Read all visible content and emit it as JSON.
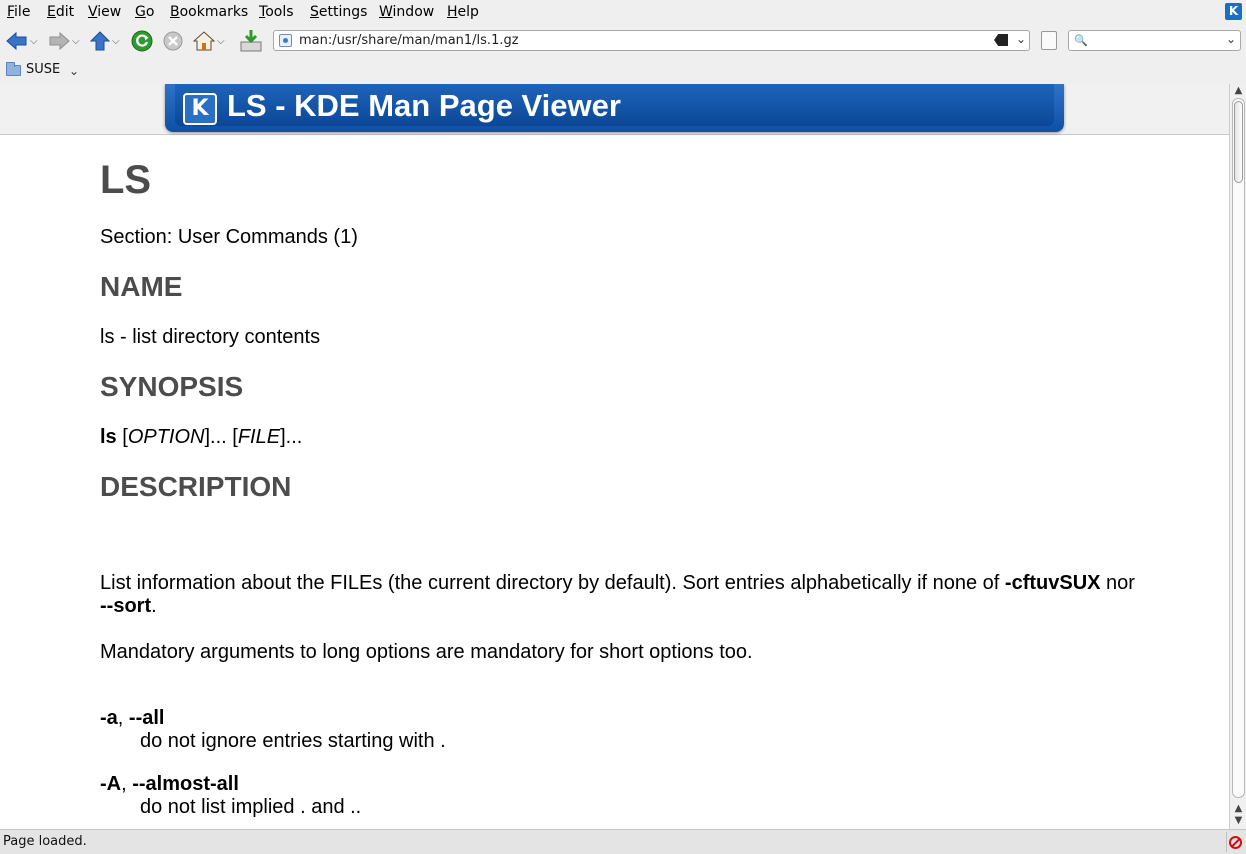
{
  "menubar": {
    "items": [
      {
        "prefix": "",
        "ul": "F",
        "rest": "ile"
      },
      {
        "prefix": "",
        "ul": "E",
        "rest": "dit"
      },
      {
        "prefix": "",
        "ul": "V",
        "rest": "iew"
      },
      {
        "prefix": "",
        "ul": "G",
        "rest": "o"
      },
      {
        "prefix": "",
        "ul": "B",
        "rest": "ookmarks"
      },
      {
        "prefix": "",
        "ul": "T",
        "rest": "ools"
      },
      {
        "prefix": "",
        "ul": "S",
        "rest": "ettings"
      },
      {
        "prefix": "",
        "ul": "W",
        "rest": "indow"
      },
      {
        "prefix": "",
        "ul": "H",
        "rest": "elp"
      }
    ]
  },
  "toolbar": {
    "url": "man:/usr/share/man/man1/ls.1.gz",
    "search_value": ""
  },
  "bookmarks": {
    "folder_label": "SUSE"
  },
  "banner": {
    "logo_letter": "K",
    "title": "LS - KDE Man Page Viewer"
  },
  "page": {
    "heading": "LS",
    "section_line": "Section: User Commands (1)",
    "name_heading": "NAME",
    "name_text": "ls - list directory contents",
    "synopsis_heading": "SYNOPSIS",
    "synopsis": {
      "cmd": "ls",
      "open1": " [",
      "opt": "OPTION",
      "mid": "]... [",
      "file": "FILE",
      "end": "]..."
    },
    "description_heading": "DESCRIPTION",
    "desc1": {
      "a": "List information about the FILEs (the current directory by default). Sort entries alphabetically if none of ",
      "b": "-cftuvSUX",
      "c": " nor",
      "d": "--sort",
      "e": "."
    },
    "desc2": "Mandatory arguments to long options are mandatory for short options too.",
    "options": [
      {
        "short": "-a",
        "sep": ", ",
        "long": "--all",
        "desc": "do not ignore entries starting with ."
      },
      {
        "short": "-A",
        "sep": ", ",
        "long": "--almost-all",
        "desc": "do not list implied . and .."
      }
    ]
  },
  "status": {
    "text": "Page loaded."
  }
}
